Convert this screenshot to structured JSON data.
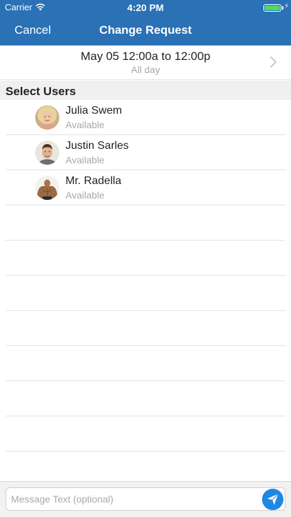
{
  "status_bar": {
    "carrier": "Carrier",
    "time": "4:20 PM",
    "battery_color": "#4cd964"
  },
  "nav": {
    "cancel_label": "Cancel",
    "title": "Change Request",
    "bar_color": "#2a71b5"
  },
  "date_row": {
    "range": "May 05 12:00a to 12:00p",
    "subtitle": "All day"
  },
  "section": {
    "label": "Select Users"
  },
  "users": [
    {
      "name": "Julia Swem",
      "status": "Available"
    },
    {
      "name": "Justin Sarles",
      "status": "Available"
    },
    {
      "name": "Mr. Radella",
      "status": "Available"
    }
  ],
  "composer": {
    "placeholder": "Message Text (optional)",
    "send_color": "#1e88e5"
  }
}
